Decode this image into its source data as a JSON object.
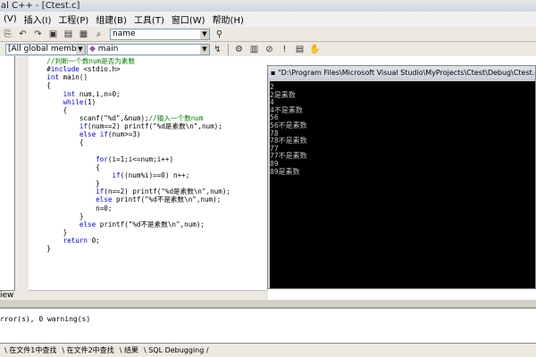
{
  "window": {
    "title": "al C++ - [Ctest.c]"
  },
  "menu": [
    "(V)",
    "插入(I)",
    "工程(P)",
    "组建(B)",
    "工具(T)",
    "窗口(W)",
    "帮助(H)"
  ],
  "toolbar": {
    "name_combo": "name"
  },
  "wizardbar": {
    "class_combo": "[All global members",
    "member_combo": "main"
  },
  "code_lines": [
    "    //判断一个数num是否为素数",
    "    #include <stdio.h>",
    "    int main()",
    "    {",
    "        int num,i,n=0;",
    "        while(1)",
    "        {",
    "            scanf(\"%d\",&num);//输入一个数num",
    "            if(num==2) printf(\"%d是素数\\n\",num);",
    "            else if(num>=3)",
    "            {",
    "",
    "                for(i=1;i<=num;i++)",
    "                {",
    "                    if((num%i)==0) n++;",
    "                }",
    "                if(n==2) printf(\"%d是素数\\n\",num);",
    "                else printf(\"%d不是素数\\n\",num);",
    "                n=0;",
    "            }",
    "            else printf(\"%d不是素数\\n\",num);",
    "        }",
    "        return 0;",
    "    }"
  ],
  "console": {
    "title": "\"D:\\Program Files\\Microsoft Visual Studio\\MyProjects\\Ctest\\Debug\\Ctest.exe\"",
    "lines": [
      "2",
      "2是素数",
      "4",
      "4不是素数",
      "56",
      "56不是素数",
      "78",
      "78不是素数",
      "77",
      "77不是素数",
      "89",
      "89是素数"
    ]
  },
  "output": {
    "text": "rror(s), 0 warning(s)"
  },
  "left_tab": "iew",
  "bottom_tabs": [
    "在文件1中查找",
    "在文件2中查找",
    "结果",
    "SQL Debugging"
  ]
}
